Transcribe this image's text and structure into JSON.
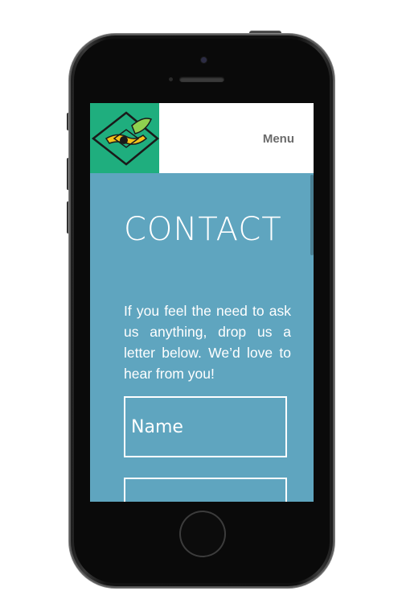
{
  "device": {
    "type": "phone mockup",
    "body_color": "#111111"
  },
  "header": {
    "logo_icon": "emblem-diamond-icon",
    "logo_bg": "#1fae7e",
    "menu_label": "Menu"
  },
  "page": {
    "title": "CONTACT",
    "intro": "If you feel the need to ask us anything, drop us a letter below. We’d love to hear from you!",
    "bg_color": "#5fa5bf"
  },
  "form": {
    "name_placeholder": "Name",
    "second_field_placeholder": ""
  }
}
